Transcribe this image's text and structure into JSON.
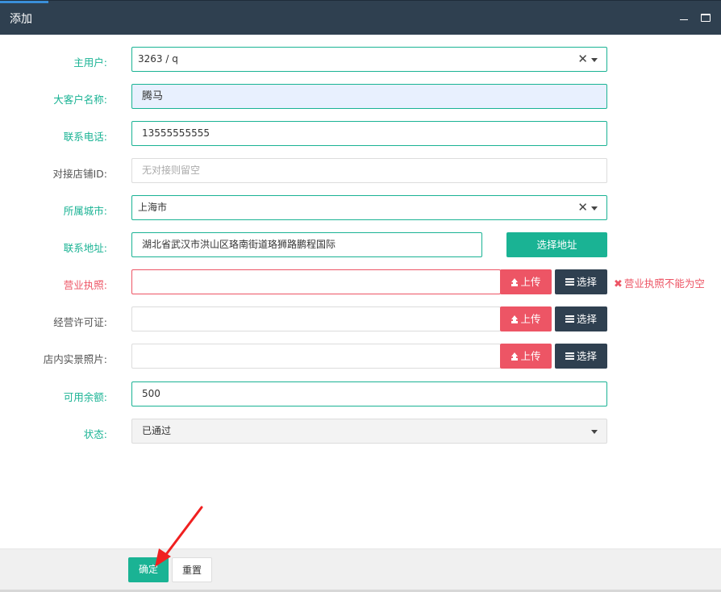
{
  "window": {
    "title": "添加"
  },
  "form": {
    "main_user": {
      "label": "主用户:",
      "value": "3263 / q"
    },
    "client_name": {
      "label": "大客户名称:",
      "value": "腾马"
    },
    "phone": {
      "label": "联系电话:",
      "value": "13555555555"
    },
    "shop_id": {
      "label": "对接店铺ID:",
      "placeholder": "无对接则留空"
    },
    "city": {
      "label": "所属城市:",
      "value": "上海市"
    },
    "address": {
      "label": "联系地址:",
      "value": "湖北省武汉市洪山区珞南街道珞狮路鹏程国际",
      "select_button": "选择地址"
    },
    "license": {
      "label": "营业执照:",
      "upload": "上传",
      "choose": "选择",
      "error": "营业执照不能为空"
    },
    "permit": {
      "label": "经营许可证:",
      "upload": "上传",
      "choose": "选择"
    },
    "store_photos": {
      "label": "店内实景照片:",
      "upload": "上传",
      "choose": "选择"
    },
    "balance": {
      "label": "可用余额:",
      "value": "500"
    },
    "status": {
      "label": "状态:",
      "value": "已通过"
    }
  },
  "footer": {
    "confirm": "确定",
    "reset": "重置"
  },
  "colors": {
    "titlebar": "#2f4050",
    "accent": "#1ab394",
    "danger": "#ed5565",
    "dark_button": "#2f4050"
  },
  "icons": {
    "clear": "clear-x-icon",
    "dropdown": "caret-down-icon",
    "upload": "upload-icon",
    "list": "list-icon",
    "error": "error-x-icon"
  }
}
